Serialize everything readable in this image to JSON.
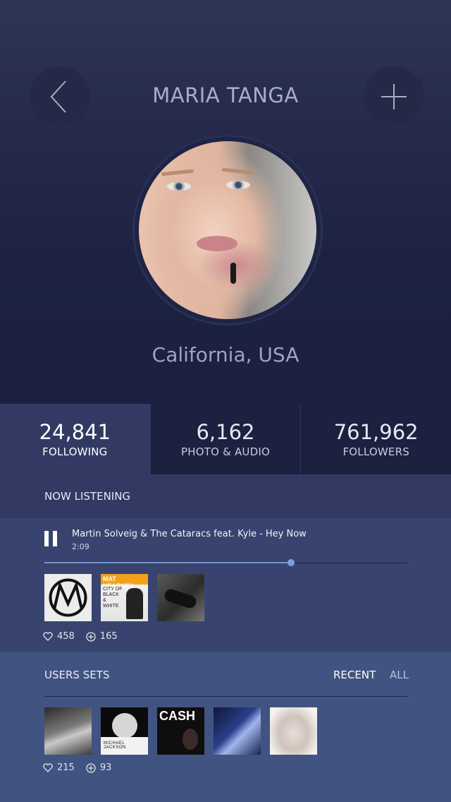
{
  "header": {
    "title": "MARIA TANGA",
    "back_icon": "chevron-left-icon",
    "add_icon": "plus-icon"
  },
  "profile": {
    "location": "California, USA"
  },
  "stats": [
    {
      "value": "24,841",
      "label": "FOLLOWING",
      "active": true
    },
    {
      "value": "6,162",
      "label": "PHOTO & AUDIO",
      "active": false
    },
    {
      "value": "761,962",
      "label": "FOLLOWERS",
      "active": false
    }
  ],
  "now_listening": {
    "label": "NOW LISTENING",
    "track": "Martin Solveig & The Cataracs feat. Kyle - Hey Now",
    "time": "2:09",
    "progress": 0.68,
    "thumbs": [
      {
        "text": ""
      },
      {
        "text": "MAT KEARNEY",
        "sub": "CITY OF BLACK & WHITE"
      },
      {
        "text": ""
      }
    ],
    "likes": "458",
    "adds": "165"
  },
  "users_sets": {
    "label": "USERS SETS",
    "tabs": [
      "RECENT",
      "ALL"
    ],
    "thumbs": [
      {
        "text": ""
      },
      {
        "text": "MICHAEL JACKSON"
      },
      {
        "text": "CASH"
      },
      {
        "text": ""
      },
      {
        "text": ""
      }
    ],
    "likes": "215",
    "adds": "93"
  },
  "colors": {
    "accent": "#7593c8",
    "active_stat": "#323a64"
  }
}
